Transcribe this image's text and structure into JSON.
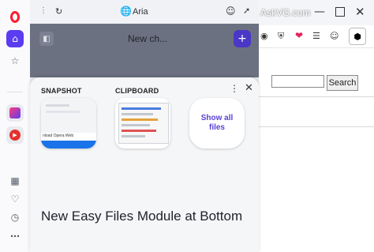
{
  "aria": {
    "title": "Aria",
    "chat_title": "New ch..."
  },
  "watermark": "AskVG.com",
  "files_module": {
    "snapshot_label": "SNAPSHOT",
    "clipboard_label": "CLIPBOARD",
    "show_all_label": "Show all files",
    "snapshot_preview_text": "nload Opera Web"
  },
  "caption": "New Easy Files Module at Bottom",
  "search": {
    "button_label": "Search",
    "value": ""
  },
  "colors": {
    "accent": "#4a37c6",
    "opera_red": "#ff1b2d",
    "show_all_text": "#5a3fd6"
  }
}
